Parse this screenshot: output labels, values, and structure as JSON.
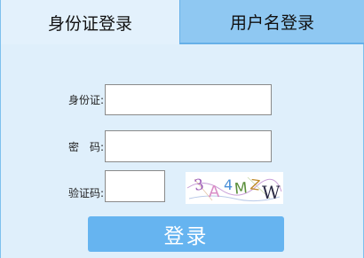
{
  "tabs": {
    "id_login": "身份证登录",
    "username_login": "用户名登录"
  },
  "form": {
    "id_label": "身份证:",
    "password_label": "密　码:",
    "captcha_label": "验证码:",
    "id_value": "",
    "password_value": "",
    "captcha_value": ""
  },
  "captcha": {
    "characters": [
      "3",
      "A",
      "4",
      "M",
      "Z",
      "W"
    ]
  },
  "login_button": "登录",
  "colors": {
    "active_tab": "#e3f1fc",
    "inactive_tab": "#8fc8f2",
    "button": "#66b4f0",
    "border": "#66b0e8"
  }
}
